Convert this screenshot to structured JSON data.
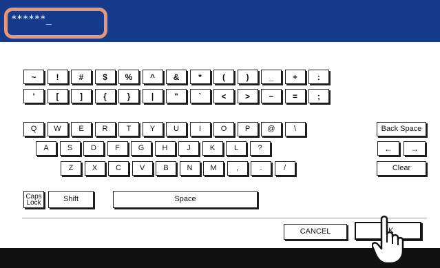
{
  "header": {
    "password_value": "******_"
  },
  "keyboard": {
    "rows": [
      [
        "~",
        "!",
        "#",
        "$",
        "%",
        "^",
        "&",
        "*",
        "(",
        ")",
        "_",
        "+",
        ":"
      ],
      [
        "'",
        "[",
        "]",
        "{",
        "}",
        "|",
        "\"",
        "`",
        "<",
        ">",
        "−",
        "=",
        ";"
      ],
      [
        "Q",
        "W",
        "E",
        "R",
        "T",
        "Y",
        "U",
        "I",
        "O",
        "P",
        "@",
        "\\"
      ],
      [
        "A",
        "S",
        "D",
        "F",
        "G",
        "H",
        "J",
        "K",
        "L",
        "?"
      ],
      [
        "Z",
        "X",
        "C",
        "V",
        "B",
        "N",
        "M",
        ",",
        ".",
        "/"
      ]
    ],
    "backspace_label": "Back Space",
    "arrow_left": "←",
    "arrow_right": "→",
    "clear_label": "Clear",
    "caps_line1": "Caps",
    "caps_line2": "Lock",
    "shift_label": "Shift",
    "space_label": "Space"
  },
  "actions": {
    "cancel_label": "CANCEL",
    "ok_label": "OK"
  },
  "colors": {
    "header_bg": "#163a8c",
    "highlight": "#e79779"
  }
}
